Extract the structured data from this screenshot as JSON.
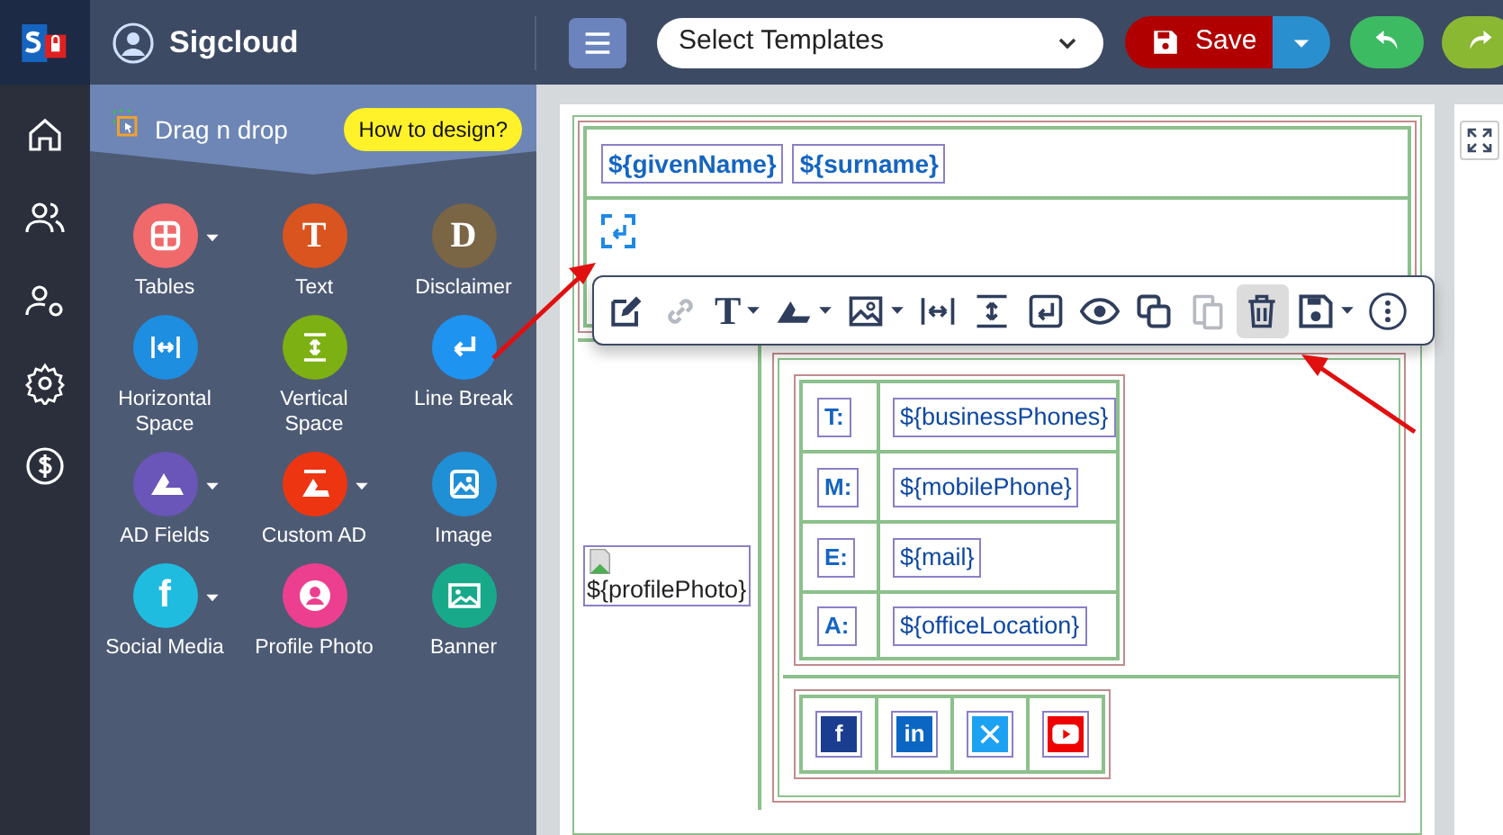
{
  "app": {
    "name": "Sigcloud"
  },
  "topbar": {
    "template_select": {
      "value": "Select Templates"
    },
    "save": "Save"
  },
  "sidebar": {
    "title": "Drag n drop",
    "help": "How to design?",
    "items": [
      {
        "kind": "tables",
        "label": "Tables",
        "color": "#f0696b",
        "has_menu": true
      },
      {
        "kind": "letter",
        "glyph": "T",
        "label": "Text",
        "color": "#d9541e",
        "has_menu": false
      },
      {
        "kind": "letter",
        "glyph": "D",
        "label": "Disclaimer",
        "color": "#7a6545",
        "has_menu": false
      },
      {
        "kind": "hspace",
        "label": "Horizontal Space",
        "color": "#1e8ee0",
        "has_menu": false
      },
      {
        "kind": "vspace",
        "label": "Vertical Space",
        "color": "#7db012",
        "has_menu": false
      },
      {
        "kind": "linebreak",
        "label": "Line Break",
        "color": "#1f93f0",
        "has_menu": false
      },
      {
        "kind": "ad",
        "label": "AD Fields",
        "color": "#6a55b8",
        "has_menu": true
      },
      {
        "kind": "customad",
        "label": "Custom AD",
        "color": "#ee3511",
        "has_menu": true
      },
      {
        "kind": "image",
        "label": "Image",
        "color": "#1f8fd6",
        "has_menu": false
      },
      {
        "kind": "social",
        "glyph": "f",
        "label": "Social Media",
        "color": "#1fbce0",
        "has_menu": true
      },
      {
        "kind": "profile",
        "label": "Profile Photo",
        "color": "#ec3f8f",
        "has_menu": false
      },
      {
        "kind": "banner",
        "label": "Banner",
        "color": "#17a98a",
        "has_menu": false
      }
    ]
  },
  "signature": {
    "name_fields": [
      "${givenName}",
      "${surname}"
    ],
    "photo": "${profilePhoto}",
    "contacts": [
      {
        "label": "T:",
        "value": "${businessPhones}"
      },
      {
        "label": "M:",
        "value": "${mobilePhone}"
      },
      {
        "label": "E:",
        "value": "${mail}"
      },
      {
        "label": "A:",
        "value": "${officeLocation}"
      }
    ],
    "social": [
      {
        "kind": "facebook",
        "glyph": "f"
      },
      {
        "kind": "linkedin",
        "glyph": "in"
      },
      {
        "kind": "x"
      },
      {
        "kind": "youtube"
      }
    ]
  },
  "editor_toolbar": {
    "tools": [
      {
        "kind": "edit",
        "disabled": false,
        "selected": false,
        "has_menu": false
      },
      {
        "kind": "link",
        "disabled": true,
        "selected": false,
        "has_menu": false
      },
      {
        "kind": "text",
        "glyph": "T",
        "disabled": false,
        "selected": false,
        "has_menu": true
      },
      {
        "kind": "ad",
        "disabled": false,
        "selected": false,
        "has_menu": true
      },
      {
        "kind": "image",
        "disabled": false,
        "selected": false,
        "has_menu": true
      },
      {
        "kind": "hspace",
        "disabled": false,
        "selected": false,
        "has_menu": false
      },
      {
        "kind": "vspace",
        "disabled": false,
        "selected": false,
        "has_menu": false
      },
      {
        "kind": "linebreak",
        "disabled": false,
        "selected": false,
        "has_menu": false
      },
      {
        "kind": "preview",
        "disabled": false,
        "selected": false,
        "has_menu": false
      },
      {
        "kind": "copy",
        "disabled": false,
        "selected": false,
        "has_menu": false
      },
      {
        "kind": "paste",
        "disabled": true,
        "selected": false,
        "has_menu": false
      },
      {
        "kind": "delete",
        "disabled": false,
        "selected": true,
        "has_menu": false
      },
      {
        "kind": "save",
        "disabled": false,
        "selected": false,
        "has_menu": true
      },
      {
        "kind": "more",
        "disabled": false,
        "selected": false,
        "has_menu": false
      }
    ]
  }
}
